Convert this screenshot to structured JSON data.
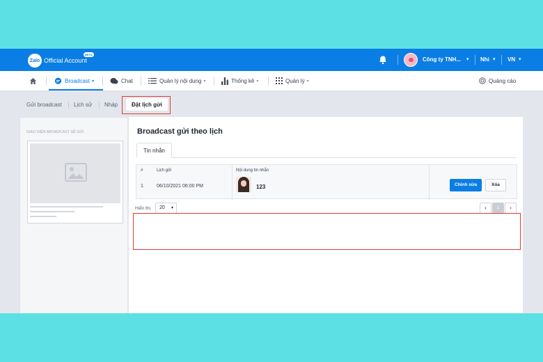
{
  "topbar": {
    "logo_mark": "Zalo",
    "logo_text": "Official Account",
    "beta": "BETA",
    "company": "Công ty TNH...",
    "user": "Nhi",
    "lang": "VN"
  },
  "nav": {
    "home_icon": "home-icon",
    "items": [
      {
        "label": "Broadcast",
        "icon": "chat-bubble-icon"
      },
      {
        "label": "Chat",
        "icon": "chat-icon"
      },
      {
        "label": "Quản lý nội dung",
        "icon": "list-icon"
      },
      {
        "label": "Thống kê",
        "icon": "bar-chart-icon"
      },
      {
        "label": "Quản lý",
        "icon": "grid-icon"
      }
    ],
    "ads": "Quảng cáo"
  },
  "subnav": {
    "items": [
      "Gửi broadcast",
      "Lịch sử",
      "Nháp"
    ],
    "active": "Đặt lịch gửi"
  },
  "preview": {
    "label": "GIAO DIỆN BROADCAST SẼ GỬI"
  },
  "main": {
    "title": "Broadcast gửi theo lịch",
    "tab": "Tin nhắn",
    "columns": [
      "#",
      "Lịch gửi",
      "Nội dung tin nhắn"
    ],
    "rows": [
      {
        "index": "1",
        "schedule": "06/10/2021 06:00 PM",
        "content": "123",
        "edit": "Chỉnh sửa",
        "delete": "Xóa"
      }
    ],
    "show_label": "Hiển thị",
    "page_size": "20",
    "page": "1"
  },
  "colors": {
    "primary": "#0a7ee4",
    "highlight": "#e53935",
    "background": "#5ce0e4"
  }
}
